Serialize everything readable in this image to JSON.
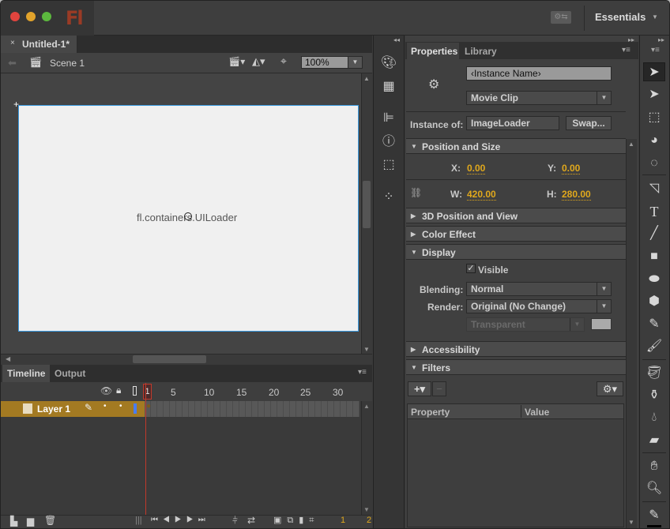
{
  "app": {
    "logo": "Fl",
    "workspace": "Essentials"
  },
  "document": {
    "tab_label": "Untitled-1*",
    "close_glyph": "×",
    "scene": "Scene 1",
    "zoom": "100%"
  },
  "stage": {
    "component_label": "fl.containers.UILoader"
  },
  "timeline": {
    "tabs": [
      "Timeline",
      "Output"
    ],
    "frame_numbers": [
      "1",
      "5",
      "10",
      "15",
      "20",
      "25",
      "30"
    ],
    "layer_name": "Layer 1",
    "current_frame": "1",
    "footer_values": [
      "1",
      "2"
    ]
  },
  "properties": {
    "tabs": [
      "Properties",
      "Library"
    ],
    "instance_name_placeholder": "‹Instance Name›",
    "symbol_type": "Movie Clip",
    "instance_of_label": "Instance of:",
    "instance_of_value": "ImageLoader",
    "swap_label": "Swap...",
    "sections": {
      "position_size": "Position and Size",
      "position_3d": "3D Position and View",
      "color_effect": "Color Effect",
      "display": "Display",
      "accessibility": "Accessibility",
      "filters": "Filters"
    },
    "x_label": "X:",
    "x_value": "0.00",
    "y_label": "Y:",
    "y_value": "0.00",
    "w_label": "W:",
    "w_value": "420.00",
    "h_label": "H:",
    "h_value": "280.00",
    "visible_label": "Visible",
    "visible_checked": true,
    "blending_label": "Blending:",
    "blending_value": "Normal",
    "render_label": "Render:",
    "render_value": "Original (No Change)",
    "bg_value": "Transparent",
    "filters_columns": [
      "Property",
      "Value"
    ]
  },
  "colors": {
    "accent_value": "#e0a81c",
    "layer_highlight": "#a37a22",
    "playhead": "#c0392b",
    "stage_border": "#3a9ae0"
  }
}
